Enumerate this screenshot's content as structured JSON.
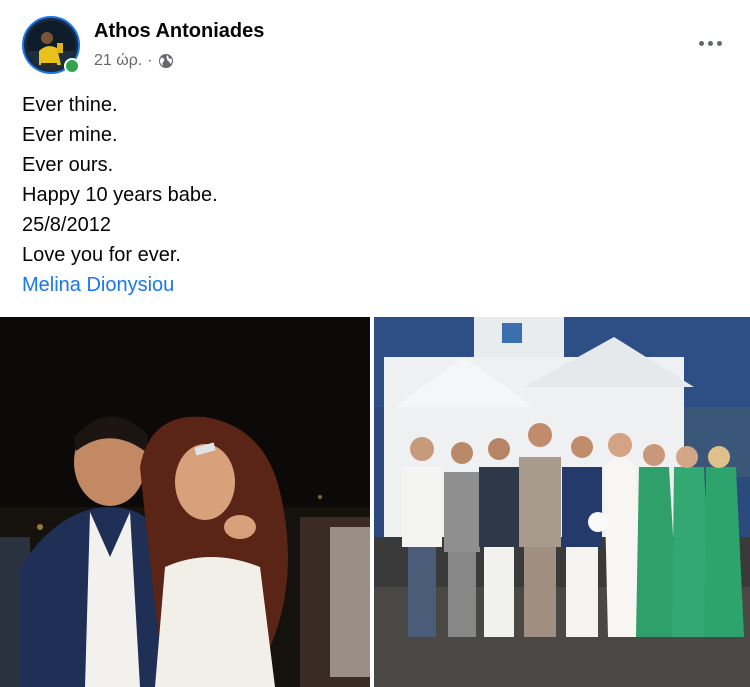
{
  "post": {
    "author": "Athos Antoniades",
    "time": "21 ώρ.",
    "separator": "·",
    "privacy_icon": "globe-icon",
    "more_icon": "more-options-icon",
    "text_lines": [
      "Ever thine.",
      "Ever mine.",
      "Ever ours.",
      "Happy 10 years babe.",
      "25/8/2012",
      "Love you for ever."
    ],
    "mention": "Melina Dionysiou"
  },
  "photos": [
    {
      "description_icon": "wedding-couple-photo"
    },
    {
      "description_icon": "wedding-party-chapel-photo"
    }
  ],
  "colors": {
    "link": "#1877f2",
    "secondary_text": "#65676b",
    "online": "#31a24c"
  }
}
